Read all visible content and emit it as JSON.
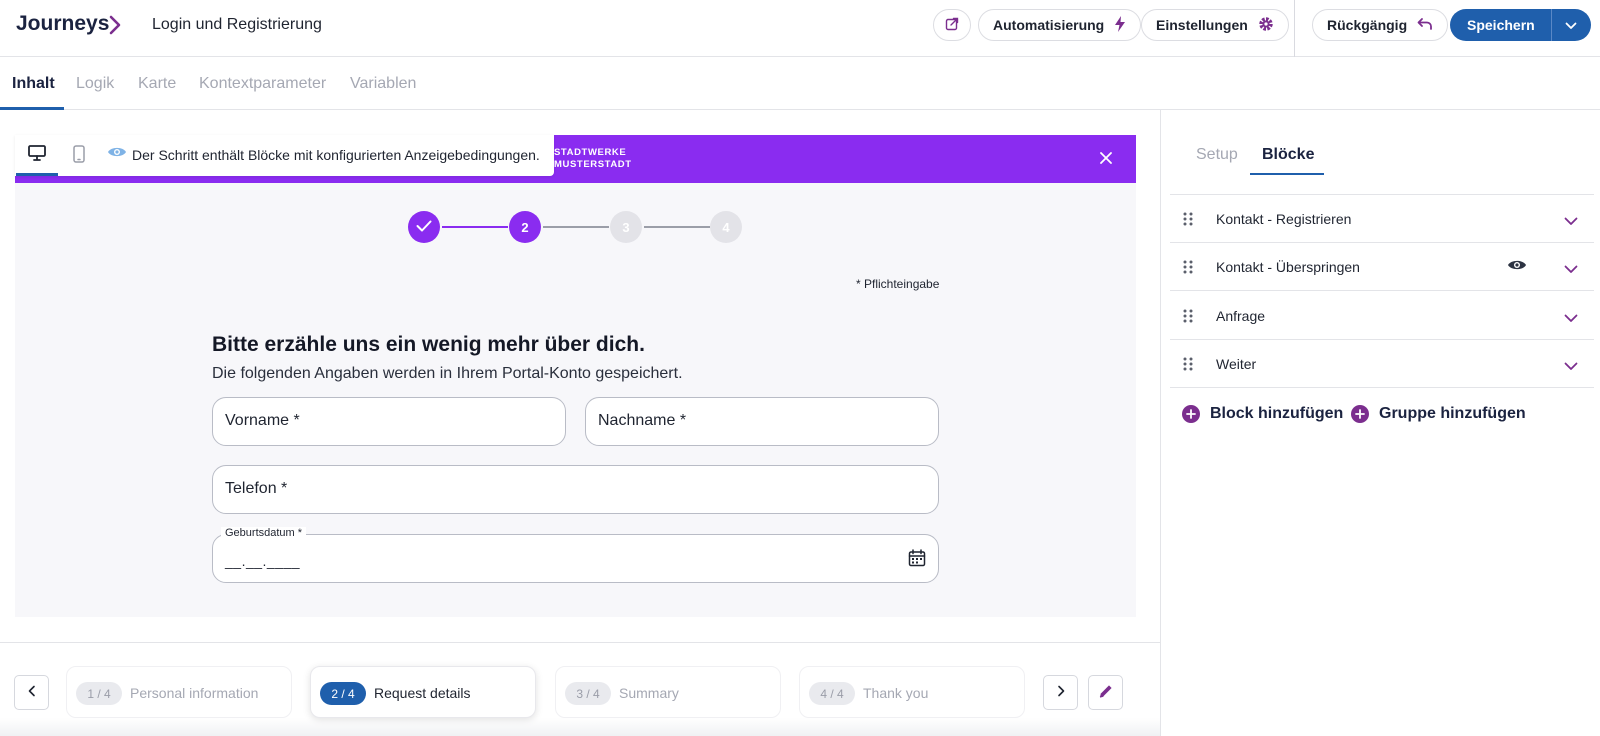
{
  "header": {
    "brand": "Journeys",
    "page_name": "Login und Registrierung",
    "automation_label": "Automatisierung",
    "settings_label": "Einstellungen",
    "undo_label": "Rückgängig",
    "save_label": "Speichern"
  },
  "tabs": [
    "Inhalt",
    "Logik",
    "Karte",
    "Kontextparameter",
    "Variablen"
  ],
  "preview": {
    "brand_line1": "STADTWERKE",
    "brand_line2": "MUSTERSTADT",
    "toolbar_text": "Der Schritt enthält Blöcke mit konfigurierten Anzeigebedingungen.",
    "steps": [
      "2",
      "3",
      "4"
    ],
    "required_note": "* Pflichteingabe",
    "form_title": "Bitte erzähle uns ein wenig mehr über dich.",
    "form_subtitle": "Die folgenden Angaben werden in Ihrem Portal-Konto gespeichert.",
    "fields": {
      "firstname": "Vorname *",
      "lastname": "Nachname *",
      "phone": "Telefon *",
      "birthdate_label": "Geburtsdatum *",
      "birthdate_mask": "__.__.____"
    }
  },
  "step_nav": [
    {
      "badge": "1 / 4",
      "label": "Personal information"
    },
    {
      "badge": "2 / 4",
      "label": "Request details"
    },
    {
      "badge": "3 / 4",
      "label": "Summary"
    },
    {
      "badge": "4 / 4",
      "label": "Thank you"
    }
  ],
  "right_panel": {
    "tabs": [
      "Setup",
      "Blöcke"
    ],
    "blocks": [
      "Kontakt - Registrieren",
      "Kontakt - Überspringen",
      "Anfrage",
      "Weiter"
    ],
    "add_block_label": "Block hinzufügen",
    "add_group_label": "Gruppe hinzufügen"
  },
  "colors": {
    "primary": "#1f5fac",
    "accent_purple": "#8a2cf0",
    "icon_purple": "#7b2e8e"
  }
}
